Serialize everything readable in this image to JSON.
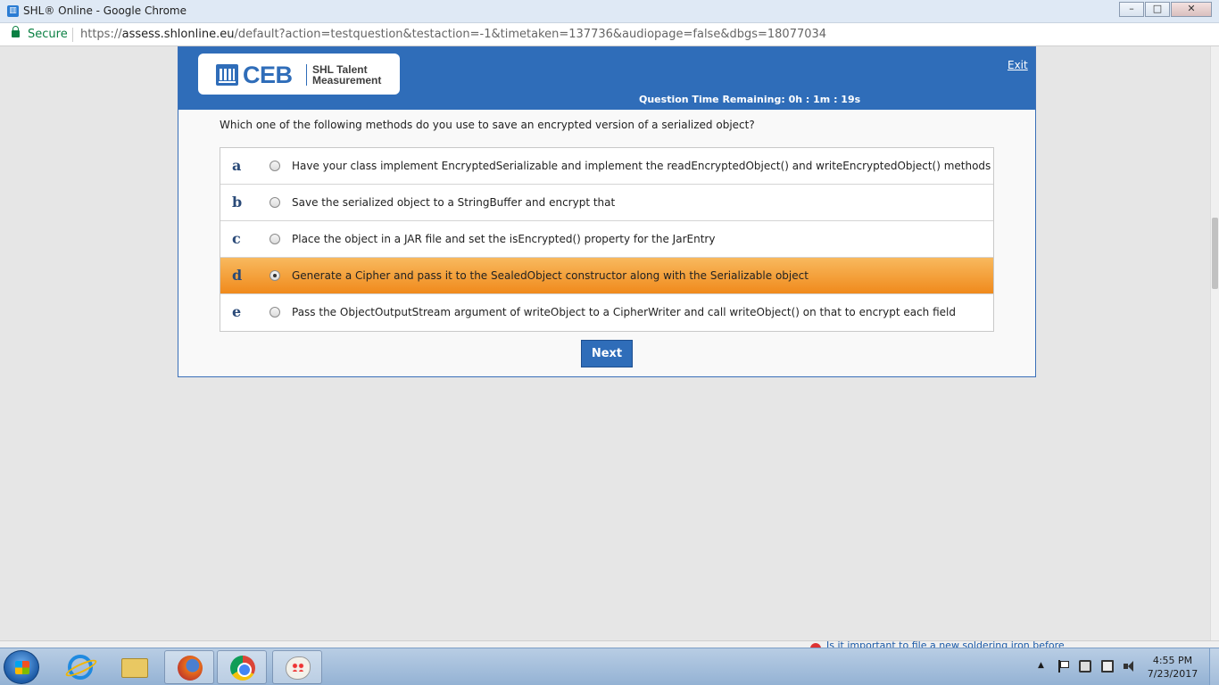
{
  "browser": {
    "window_title": "SHL® Online - Google Chrome",
    "secure_label": "Secure",
    "url_scheme": "https://",
    "url_host": "assess.shlonline.eu",
    "url_path": "/default?action=testquestion&testaction=-1&timetaken=137736&audiopage=false&dbgs=18077034",
    "window_buttons": [
      "minimize",
      "maximize",
      "close"
    ]
  },
  "header": {
    "logo_text": "CEB",
    "logo_subtitle": "SHL Talent Measurement",
    "exit_label": "Exit",
    "timer_text": "Question Time Remaining: 0h : 1m : 19s",
    "header_color": "#2f6db9"
  },
  "question": {
    "text": "Which one of the following methods do you use to save an encrypted version of a serialized object?",
    "selected": "d",
    "options": [
      {
        "letter": "a",
        "text": "Have your class implement EncryptedSerializable and implement the readEncryptedObject() and writeEncryptedObject() methods"
      },
      {
        "letter": "b",
        "text": "Save the serialized object to a StringBuffer and encrypt that"
      },
      {
        "letter": "c",
        "text": "Place the object in a JAR file and set the isEncrypted() property for the JarEntry"
      },
      {
        "letter": "d",
        "text": "Generate a Cipher and pass it to the SealedObject constructor along with the Serializable object"
      },
      {
        "letter": "e",
        "text": "Pass the ObjectOutputStream argument of writeObject to a CipherWriter and call writeObject() on that to encrypt each field"
      }
    ],
    "selected_color": "#f08a1c"
  },
  "actions": {
    "next_label": "Next"
  },
  "background_page": {
    "peek_link": "Is it important to file a new soldering iron before"
  },
  "taskbar": {
    "apps": [
      "internet-explorer-icon",
      "file-explorer-icon",
      "firefox-icon",
      "chrome-icon",
      "paint-icon"
    ],
    "active_app": "paint-icon",
    "clock_time": "4:55 PM",
    "clock_date": "7/23/2017"
  }
}
